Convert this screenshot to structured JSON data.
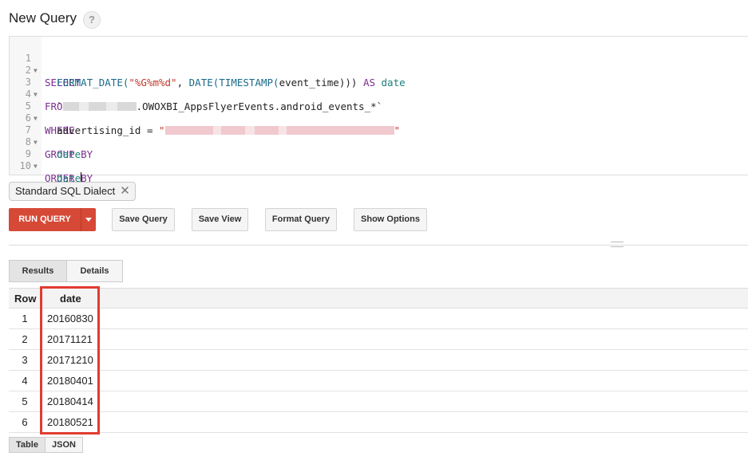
{
  "header": {
    "title": "New Query",
    "help_label": "?"
  },
  "editor": {
    "lines": [
      {
        "no": "1",
        "fold": "▼"
      },
      {
        "no": "2",
        "fold": ""
      },
      {
        "no": "3",
        "fold": "▼"
      },
      {
        "no": "4",
        "fold": ""
      },
      {
        "no": "5",
        "fold": "▼"
      },
      {
        "no": "6",
        "fold": ""
      },
      {
        "no": "7",
        "fold": "▼"
      },
      {
        "no": "8",
        "fold": ""
      },
      {
        "no": "9",
        "fold": "▼"
      },
      {
        "no": "10",
        "fold": ""
      }
    ],
    "tokens": {
      "select": "SELECT",
      "format_date": "FORMAT_DATE(",
      "format_str": "\"%G%m%d\"",
      "comma_date": ", ",
      "date_fn": "DATE(",
      "timestamp_fn": "TIMESTAMP(",
      "event_time": "event_time",
      "close_parens": "))) ",
      "as": "AS",
      "date_alias": "date",
      "from": "FROM",
      "backtick": "`",
      "table_path": ".OWOXBI_AppsFlyerEvents.android_events_*`",
      "where": "WHERE",
      "advertising_id": "advertising_id = ",
      "quote": "\"",
      "group_by": "GROUP BY",
      "order_by": "ORDER BY",
      "date_col": "date"
    }
  },
  "dialect_chip": {
    "label": "Standard SQL Dialect",
    "close": "✕"
  },
  "toolbar": {
    "run_query": "RUN QUERY",
    "save_query": "Save Query",
    "save_view": "Save View",
    "format_query": "Format Query",
    "show_options": "Show Options"
  },
  "result_tabs": {
    "results": "Results",
    "details": "Details"
  },
  "table": {
    "headers": {
      "row": "Row",
      "date": "date"
    },
    "rows": [
      {
        "row": "1",
        "date": "20160830"
      },
      {
        "row": "2",
        "date": "20171121"
      },
      {
        "row": "3",
        "date": "20171210"
      },
      {
        "row": "4",
        "date": "20180401"
      },
      {
        "row": "5",
        "date": "20180414"
      },
      {
        "row": "6",
        "date": "20180521"
      }
    ]
  },
  "view_tabs": {
    "table": "Table",
    "json": "JSON"
  },
  "colors": {
    "accent": "#d64937",
    "highlight": "#e23b30"
  }
}
